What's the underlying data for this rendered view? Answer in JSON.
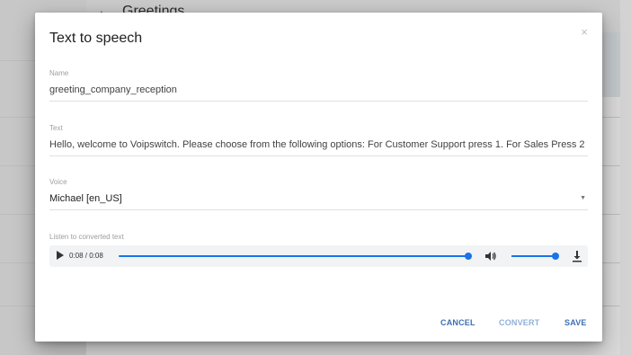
{
  "background": {
    "header_title": "Greetings",
    "back_icon": "arrow-left-icon"
  },
  "dialog": {
    "title": "Text to speech",
    "close_icon": "close-icon",
    "close_glyph": "×",
    "name": {
      "label": "Name",
      "value": "greeting_company_reception"
    },
    "text": {
      "label": "Text",
      "value": "Hello, welcome to Voipswitch. Please choose from the following options: For Customer Support press 1. For Sales Press 2"
    },
    "voice": {
      "label": "Voice",
      "value": "Michael [en_US]",
      "arrow": "▼"
    },
    "listen": {
      "label": "Listen to converted text",
      "time": "0:08 / 0:08",
      "progress": 1.0,
      "volume": 1.0
    },
    "actions": {
      "cancel": "CANCEL",
      "convert": "CONVERT",
      "save": "SAVE"
    }
  },
  "colors": {
    "accent": "#1a73e8",
    "button": "#3f6fb4",
    "button_disabled": "#8fb0da"
  }
}
